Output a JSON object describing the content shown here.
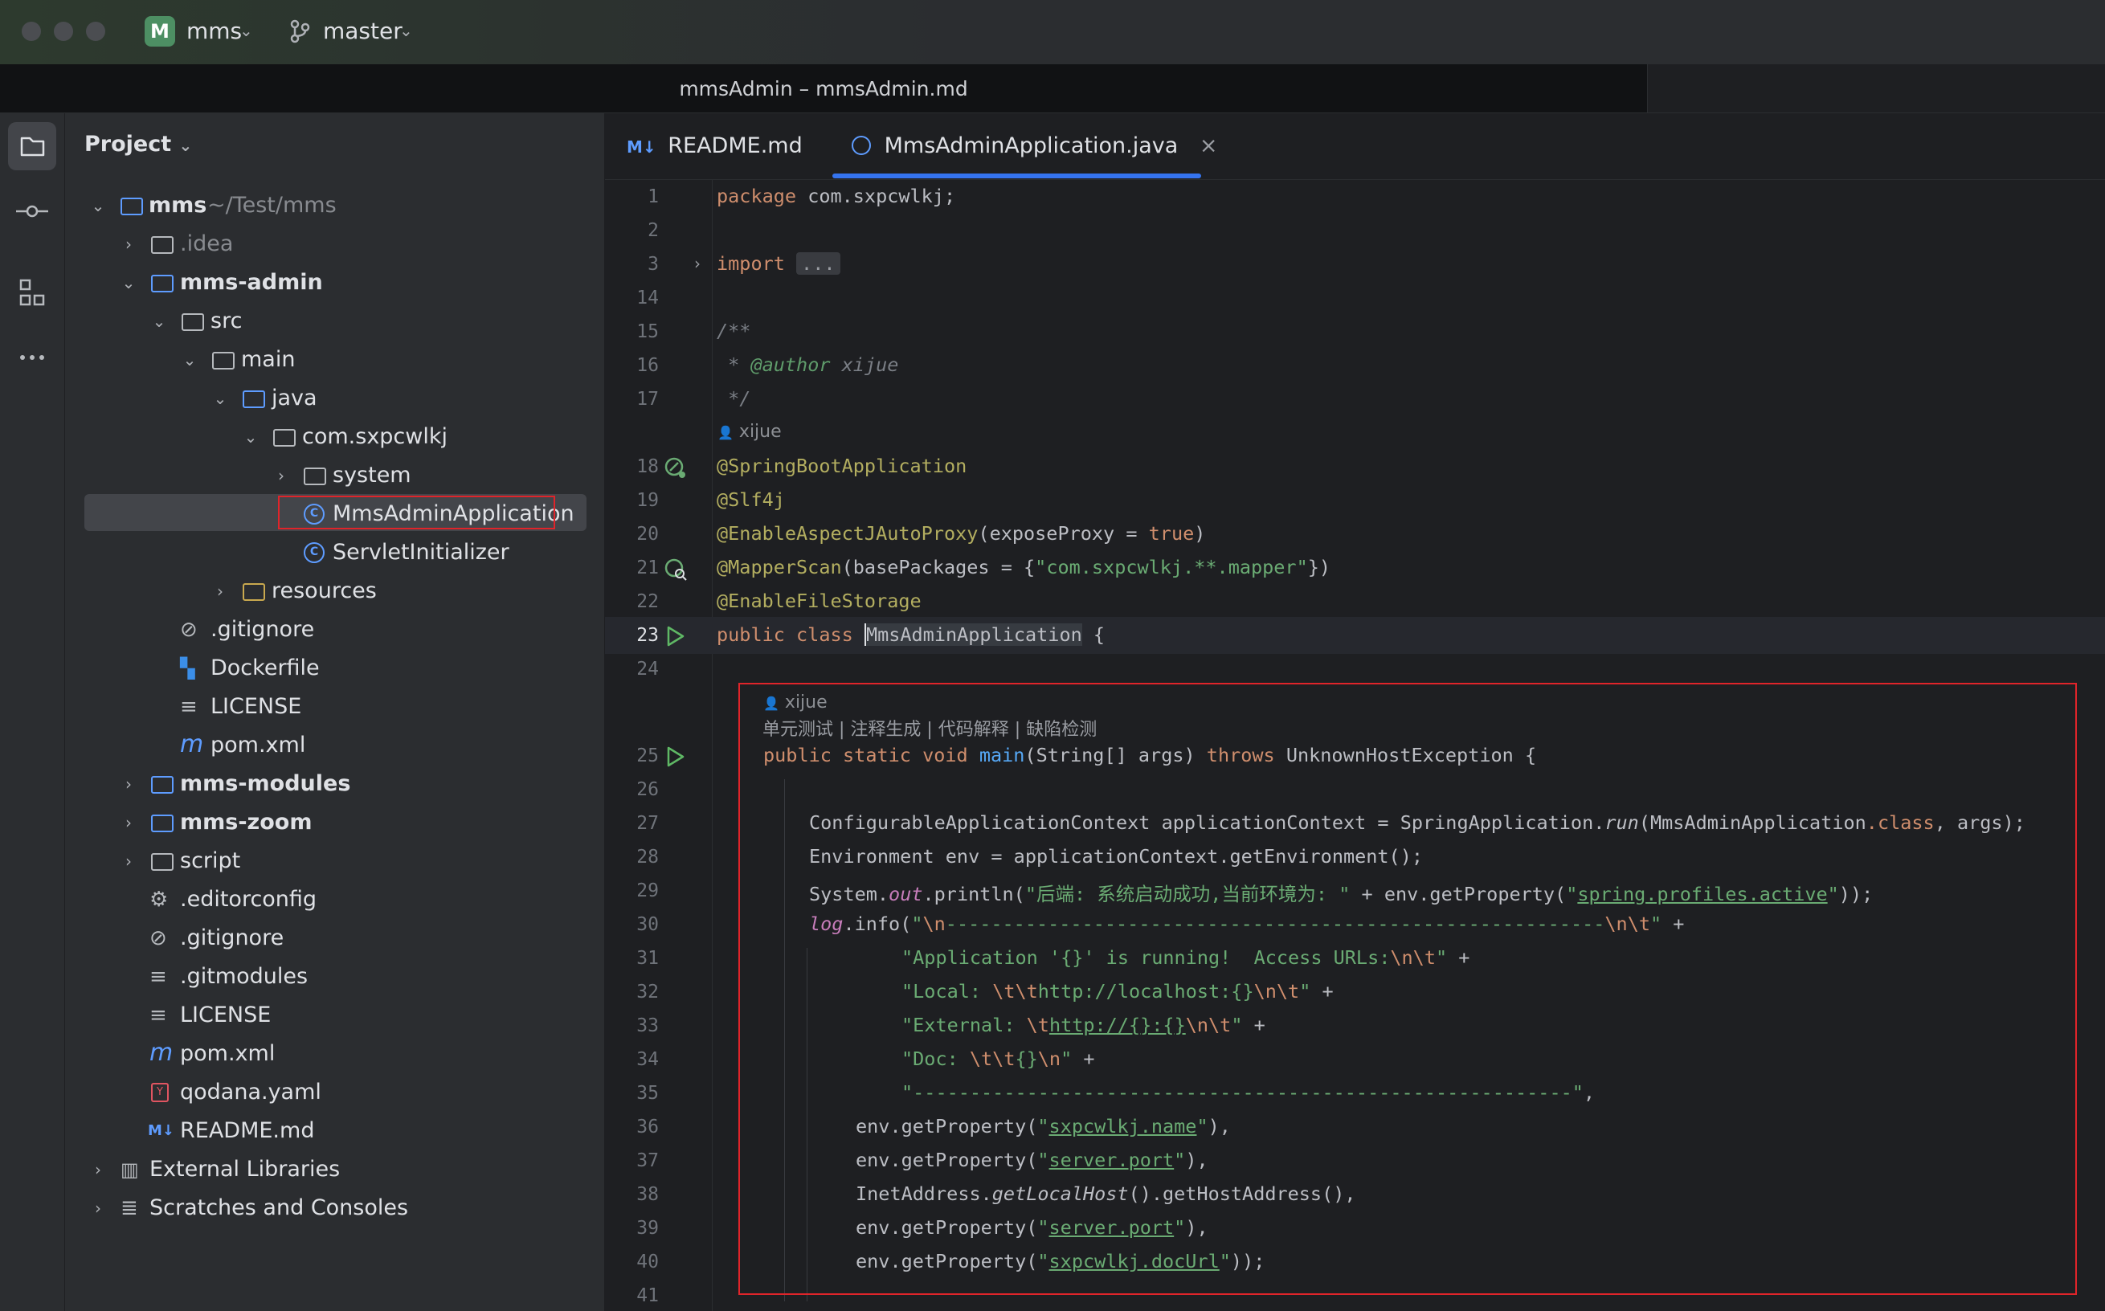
{
  "titlebar": {
    "project_badge": "M",
    "project_name": "mms",
    "branch": "master",
    "icons": [
      "branch-icon",
      "chevron-down-icon"
    ]
  },
  "window_title": "mmsAdmin – mmsAdmin.md",
  "activity_bar": [
    "folder-icon",
    "commit-icon",
    "structure-icon",
    "more-icon"
  ],
  "project_panel": {
    "title": "Project",
    "tree": [
      {
        "label": "mms",
        "suffix": "~/Test/mms",
        "bold": true
      },
      {
        "label": ".idea"
      },
      {
        "label": "mms-admin",
        "bold": true
      },
      {
        "label": "src"
      },
      {
        "label": "main"
      },
      {
        "label": "java"
      },
      {
        "label": "com.sxpcwlkj"
      },
      {
        "label": "system"
      },
      {
        "label": "MmsAdminApplication",
        "selected": true
      },
      {
        "label": "ServletInitializer"
      },
      {
        "label": "resources"
      },
      {
        "label": ".gitignore"
      },
      {
        "label": "Dockerfile"
      },
      {
        "label": "LICENSE"
      },
      {
        "label": "pom.xml"
      },
      {
        "label": "mms-modules",
        "bold": true
      },
      {
        "label": "mms-zoom",
        "bold": true
      },
      {
        "label": "script"
      },
      {
        "label": ".editorconfig"
      },
      {
        "label": ".gitignore"
      },
      {
        "label": ".gitmodules"
      },
      {
        "label": "LICENSE"
      },
      {
        "label": "pom.xml"
      },
      {
        "label": "qodana.yaml"
      },
      {
        "label": "README.md"
      },
      {
        "label": "External Libraries"
      },
      {
        "label": "Scratches and Consoles"
      }
    ]
  },
  "tabs": [
    {
      "label": "README.md",
      "badge": "M↓",
      "active": false
    },
    {
      "label": "MmsAdminApplication.java",
      "active": true,
      "close": "×"
    }
  ],
  "editor": {
    "line_numbers": [
      "1",
      "2",
      "3",
      "14",
      "15",
      "16",
      "17",
      "18",
      "19",
      "20",
      "21",
      "22",
      "23",
      "24",
      "25",
      "26",
      "27",
      "28",
      "29",
      "30",
      "31",
      "32",
      "33",
      "34",
      "35",
      "36",
      "37",
      "38",
      "39",
      "40",
      "41"
    ],
    "current_line": "23",
    "author_hint_1": "xijue",
    "author_hint_2": "xijue",
    "ai_actions": "单元测试 | 注释生成 | 代码解释 | 缺陷检测",
    "code": {
      "l1_kw": "package",
      "l1_rest": " com.sxpcwlkj;",
      "l3_kw": "import",
      "l3_fold": "...",
      "l15": "/**",
      "l16_star": " * ",
      "l16_tag": "@author",
      "l16_val": " xijue",
      "l17": " */",
      "l18": "@SpringBootApplication",
      "l19": "@Slf4j",
      "l20_an": "@EnableAspectJAutoProxy",
      "l20_a": "(exposeProxy = ",
      "l20_kw": "true",
      "l20_b": ")",
      "l21_an": "@MapperScan",
      "l21_a": "(basePackages = {",
      "l21_st": "\"com.sxpcwlkj.**.mapper\"",
      "l21_b": "})",
      "l22": "@EnableFileStorage",
      "l23_kw": "public class",
      "l23_cls": "MmsAdminApplication",
      "l23_rest": " {",
      "l25_kw": "public static void",
      "l25_fn": "main",
      "l25_a": "(String[] args) ",
      "l25_kw2": "throws",
      "l25_b": " UnknownHostException {",
      "l27_a": "ConfigurableApplicationContext applicationContext = SpringApplication.",
      "l27_it": "run",
      "l27_b": "(MmsAdminApplication",
      "l27_kw": ".class",
      "l27_c": ", args);",
      "l28": "Environment env = applicationContext.getEnvironment();",
      "l29_a": "System.",
      "l29_fld": "out",
      "l29_b": ".println(",
      "l29_st": "\"后端: 系统启动成功,当前环境为: \"",
      "l29_c": " + env.getProperty(",
      "l29_q1": "\"",
      "l29_lnk": "spring.profiles.active",
      "l29_q2": "\"",
      "l29_d": "));",
      "l30_fld": "log",
      "l30_a": ".info(",
      "l30_st1": "\"",
      "l30_esc1": "\\n",
      "l30_st2": "----------------------------------------------------------",
      "l30_esc2": "\\n\\t",
      "l30_st3": "\"",
      "l30_b": " +",
      "l31_st": "\"Application '{}' is running!  Access URLs:",
      "l31_esc": "\\n\\t",
      "l31_q": "\"",
      "l31_b": " +",
      "l32_st1": "\"Local: ",
      "l32_esc1": "\\t\\t",
      "l32_st2": "http://localhost:{}",
      "l32_esc2": "\\n\\t",
      "l32_q": "\"",
      "l32_b": " +",
      "l33_st1": "\"External: ",
      "l33_esc1": "\\t",
      "l33_lnk": "http://{}:{}",
      "l33_esc2": "\\n\\t",
      "l33_q": "\"",
      "l33_b": " +",
      "l34_st1": "\"Doc: ",
      "l34_esc1": "\\t\\t",
      "l34_st2": "{}",
      "l34_esc2": "\\n",
      "l34_q": "\"",
      "l34_b": " +",
      "l35_st": "\"----------------------------------------------------------\"",
      "l35_b": ",",
      "l36_a": "env.getProperty(",
      "l36_q1": "\"",
      "l36_lnk": "sxpcwlkj.name",
      "l36_q2": "\"",
      "l36_b": "),",
      "l37_a": "env.getProperty(",
      "l37_q1": "\"",
      "l37_lnk": "server.port",
      "l37_q2": "\"",
      "l37_b": "),",
      "l38_a": "InetAddress.",
      "l38_it": "getLocalHost",
      "l38_b": "().getHostAddress(),",
      "l39_a": "env.getProperty(",
      "l39_q1": "\"",
      "l39_lnk": "server.port",
      "l39_q2": "\"",
      "l39_b": "),",
      "l40_a": "env.getProperty(",
      "l40_q1": "\"",
      "l40_lnk": "sxpcwlkj.docUrl",
      "l40_q2": "\"",
      "l40_b": "));"
    }
  },
  "colors": {
    "accent": "#3574f0",
    "highlight_box": "#e0242a",
    "keyword": "#cf8e6d",
    "string": "#6aab73",
    "annotation": "#b3ae60"
  }
}
